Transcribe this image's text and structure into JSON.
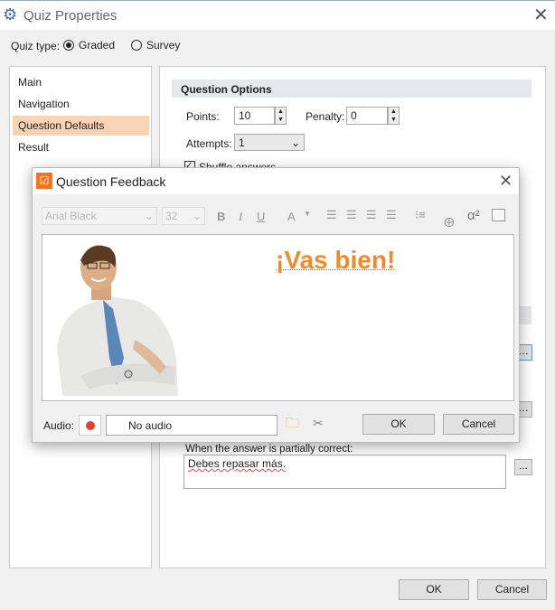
{
  "window": {
    "title": "Quiz Properties",
    "close": "✕"
  },
  "quiz_type": {
    "label": "Quiz type:",
    "options": [
      "Graded",
      "Survey"
    ],
    "selected": "Graded"
  },
  "sidebar": {
    "items": [
      {
        "label": "Main"
      },
      {
        "label": "Navigation"
      },
      {
        "label": "Question Defaults",
        "selected": true
      },
      {
        "label": "Result"
      }
    ]
  },
  "question_options": {
    "header": "Question Options",
    "points_label": "Points:",
    "points": "10",
    "penalty_label": "Penalty:",
    "penalty": "0",
    "attempts_label": "Attempts:",
    "attempts": "1",
    "shuffle_label": "Shuffle answers",
    "shuffle_checked": true
  },
  "feedback": {
    "partial_label": "When the answer is partially correct:",
    "partial_text": "Debes repasar más.",
    "more_button": "..."
  },
  "footer": {
    "ok": "OK",
    "cancel": "Cancel"
  },
  "dialog": {
    "title": "Question Feedback",
    "close": "✕",
    "toolbar": {
      "font": "Arial Black",
      "size": "32",
      "bold": "B",
      "italic": "I",
      "underline": "U",
      "font_color": "A",
      "superscript": "α²"
    },
    "content_text": "¡Vas bien!",
    "content_color": "#f08a2c",
    "audio_label": "Audio:",
    "audio_value": "No audio",
    "ok": "OK",
    "cancel": "Cancel"
  },
  "colors": {
    "accent": "#f5cba7",
    "brand": "#ee7623",
    "record": "#e8402a"
  }
}
